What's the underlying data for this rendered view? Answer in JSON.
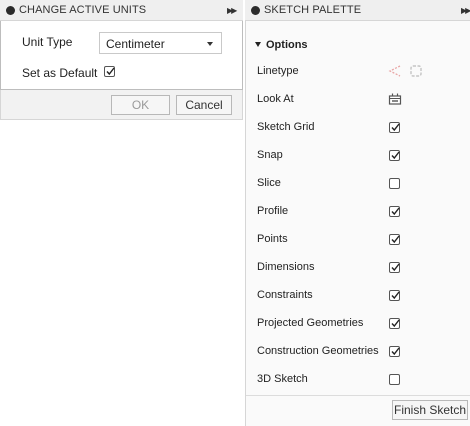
{
  "units_dialog": {
    "title": "CHANGE ACTIVE UNITS",
    "unit_type_label": "Unit Type",
    "unit_type_value": "Centimeter",
    "set_default_label": "Set as Default",
    "set_default_checked": true,
    "ok_label": "OK",
    "cancel_label": "Cancel"
  },
  "sketch_palette": {
    "title": "SKETCH PALETTE",
    "options_label": "Options",
    "rows": [
      {
        "label": "Linetype",
        "control": "linetype-icons"
      },
      {
        "label": "Look At",
        "control": "look-at-icon"
      },
      {
        "label": "Sketch Grid",
        "control": "checkbox",
        "checked": true
      },
      {
        "label": "Snap",
        "control": "checkbox",
        "checked": true
      },
      {
        "label": "Slice",
        "control": "checkbox",
        "checked": false
      },
      {
        "label": "Profile",
        "control": "checkbox",
        "checked": true
      },
      {
        "label": "Points",
        "control": "checkbox",
        "checked": true
      },
      {
        "label": "Dimensions",
        "control": "checkbox",
        "checked": true
      },
      {
        "label": "Constraints",
        "control": "checkbox",
        "checked": true
      },
      {
        "label": "Projected Geometries",
        "control": "checkbox",
        "checked": true
      },
      {
        "label": "Construction Geometries",
        "control": "checkbox",
        "checked": true
      },
      {
        "label": "3D Sketch",
        "control": "checkbox",
        "checked": false
      }
    ],
    "finish_label": "Finish Sketch"
  },
  "icons": {
    "header": "panel-dot-icon",
    "expand": "double-chevron-right-icon"
  }
}
